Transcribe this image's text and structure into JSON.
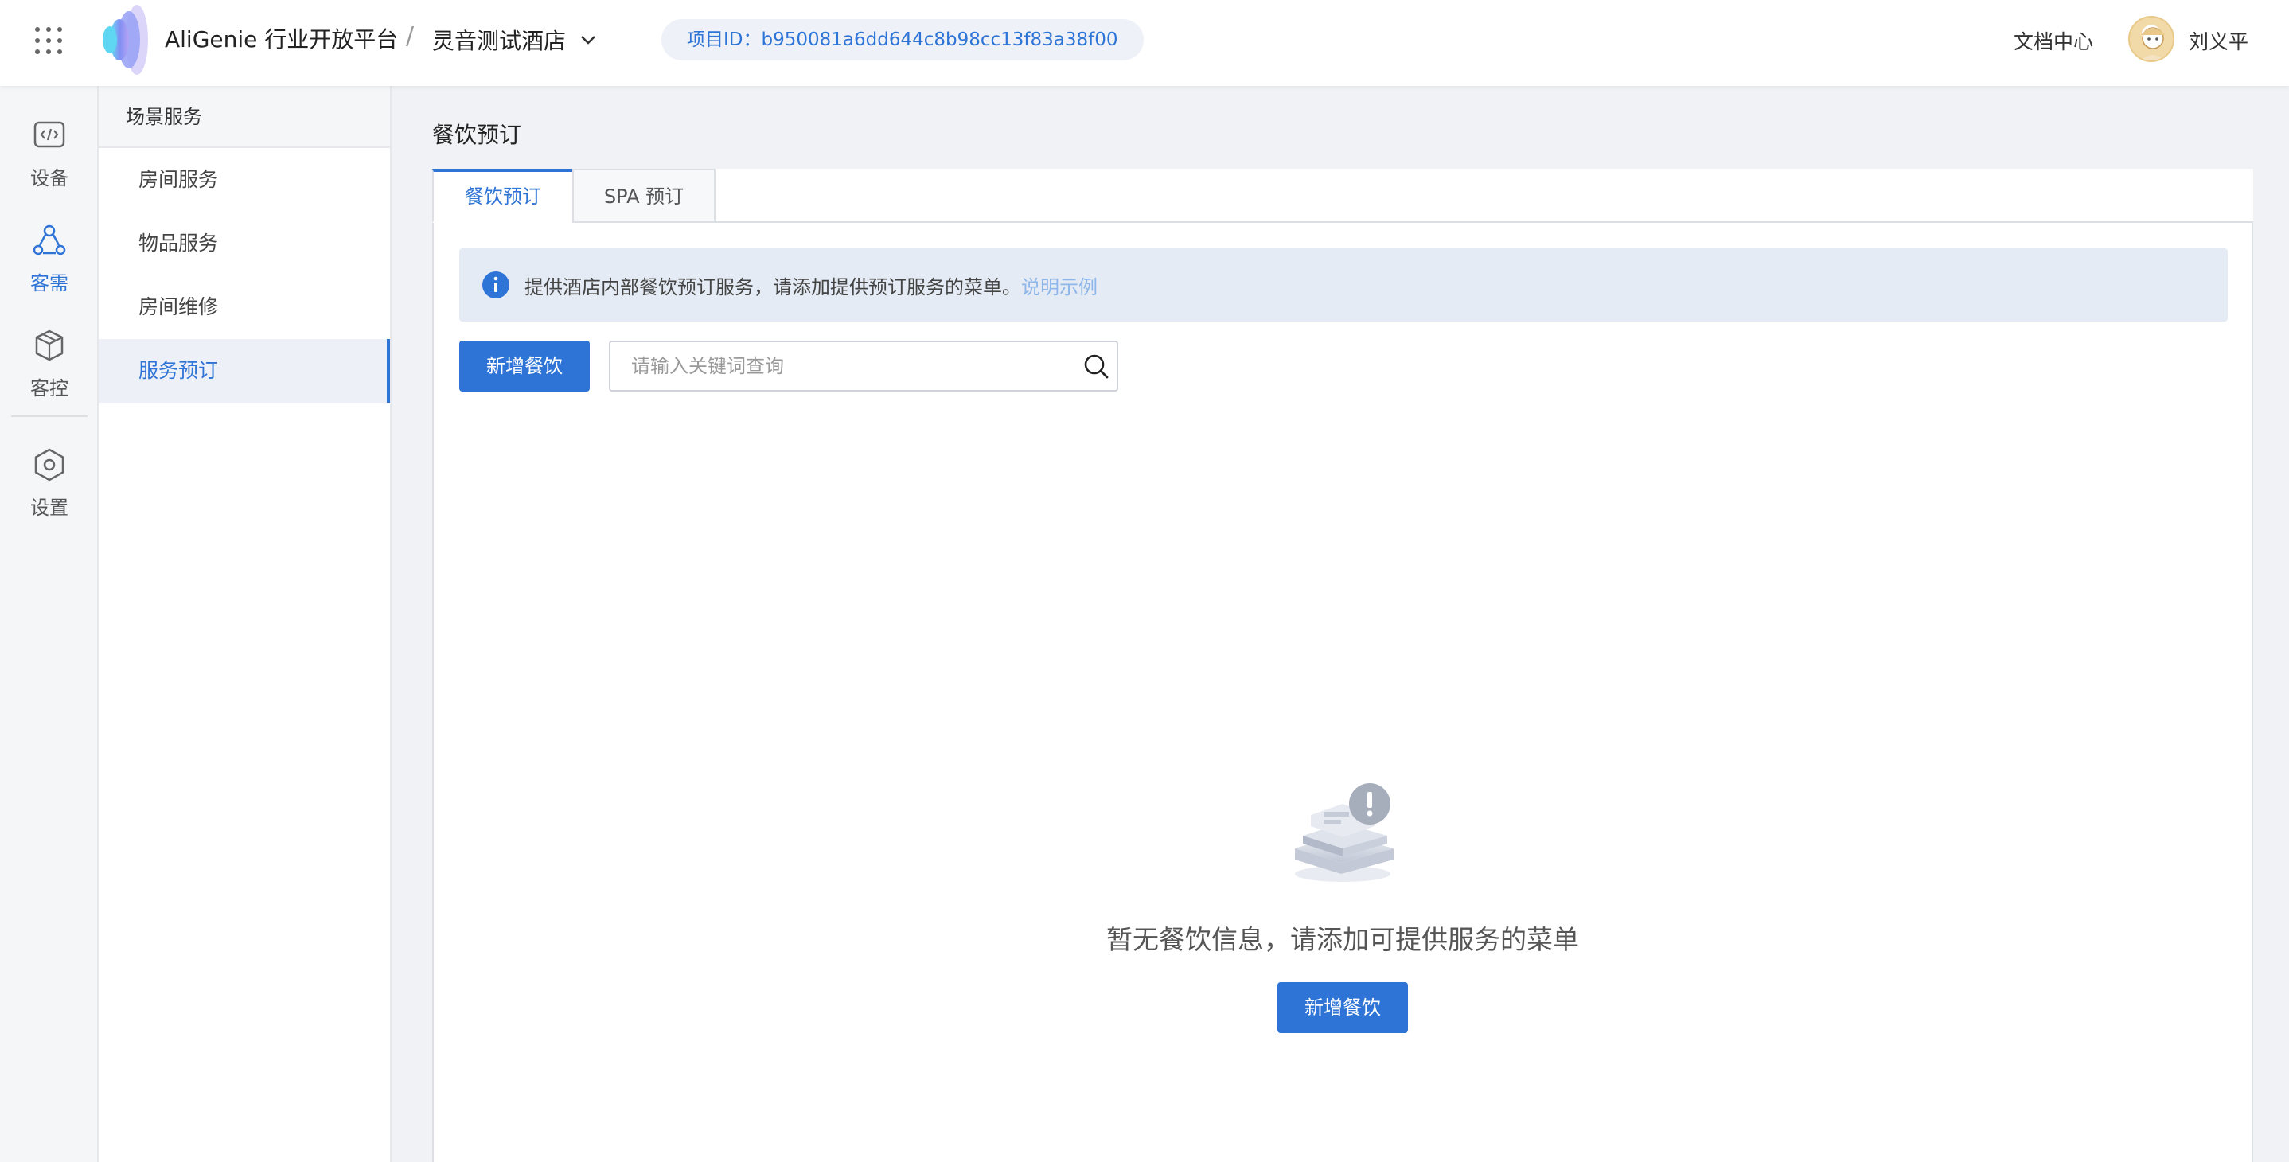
{
  "header": {
    "brand": "AliGenie 行业开放平台",
    "separator": "/",
    "project_name": "灵音测试酒店",
    "project_id": "项目ID：b950081a6dd644c8b98cc13f83a38f00",
    "docs_link": "文档中心",
    "user_name": "刘义平"
  },
  "rail": {
    "items": [
      {
        "label": "设备",
        "icon": "code-device-icon"
      },
      {
        "label": "客需",
        "icon": "guest-needs-icon"
      },
      {
        "label": "客控",
        "icon": "cube-control-icon"
      },
      {
        "label": "设置",
        "icon": "hex-settings-icon"
      }
    ],
    "active": "客需"
  },
  "subnav": {
    "heading": "场景服务",
    "items": [
      "房间服务",
      "物品服务",
      "房间维修",
      "服务预订"
    ],
    "active": "服务预订"
  },
  "main": {
    "title": "餐饮预订",
    "tabs": [
      "餐饮预订",
      "SPA 预订"
    ],
    "active_tab": "餐饮预订",
    "notice": {
      "text": "提供酒店内部餐饮预订服务，请添加提供预订服务的菜单。",
      "link": "说明示例"
    },
    "add_button": "新增餐饮",
    "search": {
      "placeholder": "请输入关键词查询",
      "value": ""
    },
    "empty": {
      "text": "暂无餐饮信息，请添加可提供服务的菜单",
      "button": "新增餐饮"
    }
  },
  "colors": {
    "accent": "#2e74d6",
    "notice_bg": "#e4ebf4",
    "link_light": "#8db6ea"
  }
}
